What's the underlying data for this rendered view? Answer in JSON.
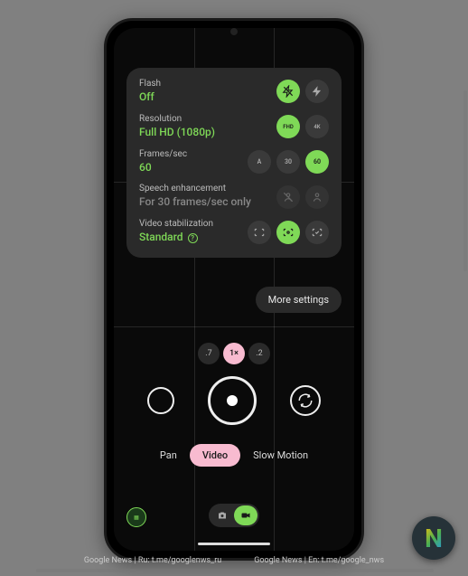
{
  "settings": {
    "flash": {
      "label": "Flash",
      "value": "Off"
    },
    "resolution": {
      "label": "Resolution",
      "value": "Full HD (1080p)"
    },
    "fps": {
      "label": "Frames/sec",
      "value": "60",
      "opts": [
        "A",
        "30",
        "60"
      ]
    },
    "speech": {
      "label": "Speech enhancement",
      "value": "For 30 frames/sec only"
    },
    "stab": {
      "label": "Video stabilization",
      "value": "Standard"
    }
  },
  "more_settings": "More settings",
  "zoom": {
    "opts": [
      ".7",
      "1×",
      ".2"
    ],
    "active": 1
  },
  "modes": {
    "items": [
      "Pan",
      "Video",
      "Slow Motion"
    ],
    "active": 1
  },
  "watermark": {
    "left": "Google News | Ru: t.me/googlenws_ru",
    "right": "Google News | En: t.me/google_nws"
  },
  "logo": "N"
}
